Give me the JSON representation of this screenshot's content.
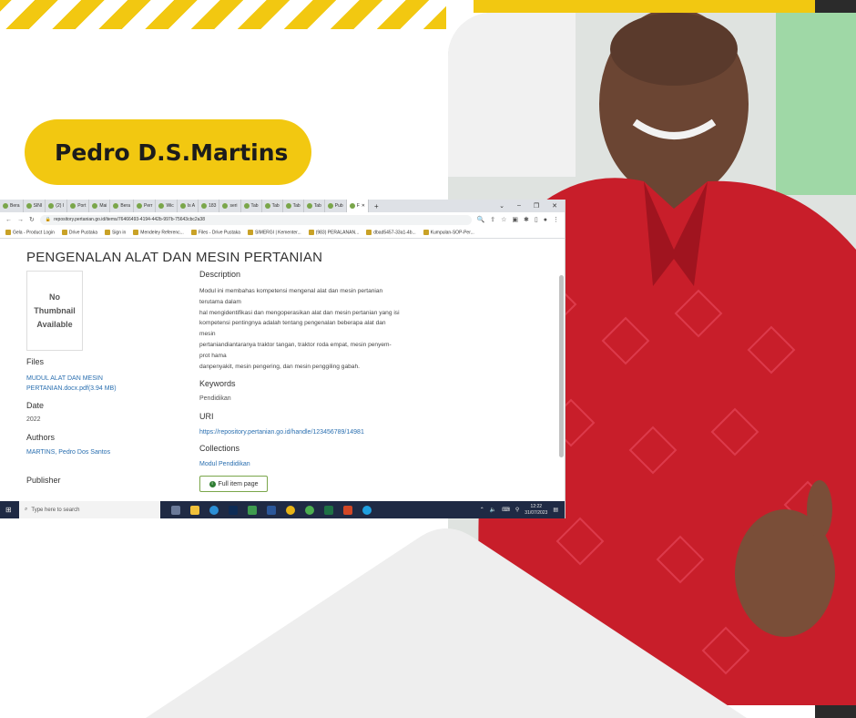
{
  "banner": {
    "name": "Pedro D.S.Martins"
  },
  "colors": {
    "accent": "#f2c811",
    "shirt": "#c81e2a",
    "link": "#2a6fb0"
  },
  "browser": {
    "tabs": [
      "Bera",
      "SINI",
      "(2) I",
      "Port",
      "Mai",
      "Bera",
      "Perr",
      "Wic",
      "Is A",
      "183",
      "seri",
      "Tab",
      "Tab",
      "Tab",
      "Tab",
      "Pub",
      "F"
    ],
    "url": "repository.pertanian.go.id/items/76466493-4194-442b-997b-75643cbc2a38",
    "bookmarks": [
      "Gela - Product Login",
      "Drive Pustaka",
      "Sign in",
      "Mendeley Referenc...",
      "Files - Drive Pustaka",
      "SIMERGI | Kementer...",
      "(983) PERALANAN...",
      "dbad5457-33a1-4b...",
      "Kumpulan-SOP-Per..."
    ]
  },
  "item": {
    "title": "PENGENALAN ALAT DAN MESIN PERTANIAN",
    "thumbnail": "No Thumbnail Available",
    "files_heading": "Files",
    "file_link": "MUDUL ALAT DAN MESIN PERTANIAN.docx.pdf(3.94 MB)",
    "date_heading": "Date",
    "date": "2022",
    "authors_heading": "Authors",
    "authors": "MARTINS, Pedro Dos Santos",
    "publisher_heading": "Publisher",
    "description_heading": "Description",
    "description_lines": [
      "Modul ini membahas kompetensi mengenal alat dan mesin pertanian",
      "terutama dalam",
      "hal mengidentifikasi dan mengoperasikan alat dan mesin pertanian yang isi",
      "kompetensi pentingnya adalah tentang pengenalan beberapa alat dan",
      "mesin",
      "pertaniandiantaranya traktor tangan, traktor roda empat, mesin penyem-",
      "prot hama",
      "danpenyakit, mesin pengering, dan mesin penggiling gabah."
    ],
    "keywords_heading": "Keywords",
    "keywords": "Pendidikan",
    "uri_heading": "URI",
    "uri": "https://repository.pertanian.go.id/handle/123456789/14981",
    "collections_heading": "Collections",
    "collection": "Modul Pendidikan",
    "full_item_button": "Full item page"
  },
  "taskbar": {
    "search_placeholder": "Type here to search",
    "time": "12:22",
    "date": "31/07/2023"
  }
}
